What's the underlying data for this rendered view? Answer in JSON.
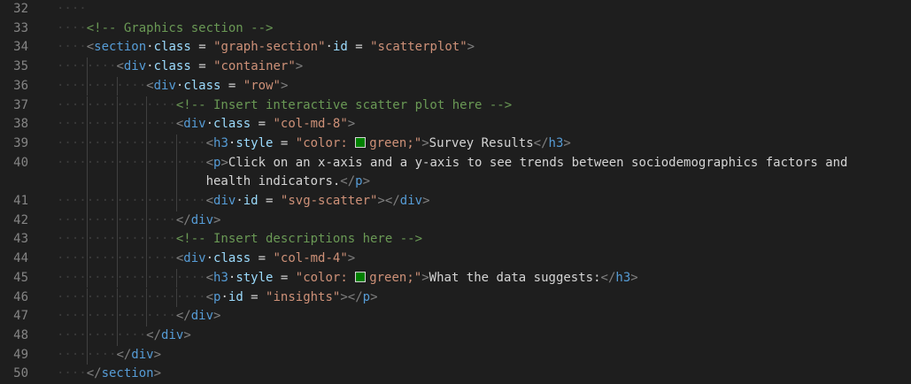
{
  "editor": {
    "swatch_color": "#008000",
    "lines": [
      {
        "number": "32",
        "indent": 4,
        "tokens": []
      },
      {
        "number": "33",
        "indent": 4,
        "tokens": [
          {
            "t": "comment",
            "v": "<!-- Graphics section -->"
          }
        ]
      },
      {
        "number": "34",
        "indent": 4,
        "tokens": [
          {
            "t": "punct",
            "v": "<"
          },
          {
            "t": "tag",
            "v": "section"
          },
          {
            "t": "text",
            "v": " "
          },
          {
            "t": "attr",
            "v": "class"
          },
          {
            "t": "text",
            "v": " = "
          },
          {
            "t": "string",
            "v": "\"graph-section\""
          },
          {
            "t": "text",
            "v": " "
          },
          {
            "t": "attr",
            "v": "id"
          },
          {
            "t": "text",
            "v": " = "
          },
          {
            "t": "string",
            "v": "\"scatterplot\""
          },
          {
            "t": "punct",
            "v": ">"
          }
        ]
      },
      {
        "number": "35",
        "indent": 8,
        "tokens": [
          {
            "t": "punct",
            "v": "<"
          },
          {
            "t": "tag",
            "v": "div"
          },
          {
            "t": "text",
            "v": " "
          },
          {
            "t": "attr",
            "v": "class"
          },
          {
            "t": "text",
            "v": " = "
          },
          {
            "t": "string",
            "v": "\"container\""
          },
          {
            "t": "punct",
            "v": ">"
          }
        ]
      },
      {
        "number": "36",
        "indent": 12,
        "tokens": [
          {
            "t": "punct",
            "v": "<"
          },
          {
            "t": "tag",
            "v": "div"
          },
          {
            "t": "text",
            "v": " "
          },
          {
            "t": "attr",
            "v": "class"
          },
          {
            "t": "text",
            "v": " = "
          },
          {
            "t": "string",
            "v": "\"row\""
          },
          {
            "t": "punct",
            "v": ">"
          }
        ]
      },
      {
        "number": "37",
        "indent": 16,
        "tokens": [
          {
            "t": "comment",
            "v": "<!-- Insert interactive scatter plot here -->"
          }
        ]
      },
      {
        "number": "38",
        "indent": 16,
        "tokens": [
          {
            "t": "punct",
            "v": "<"
          },
          {
            "t": "tag",
            "v": "div"
          },
          {
            "t": "text",
            "v": " "
          },
          {
            "t": "attr",
            "v": "class"
          },
          {
            "t": "text",
            "v": " = "
          },
          {
            "t": "string",
            "v": "\"col-md-8\""
          },
          {
            "t": "punct",
            "v": ">"
          }
        ]
      },
      {
        "number": "39",
        "indent": 20,
        "tokens": [
          {
            "t": "punct",
            "v": "<"
          },
          {
            "t": "tag",
            "v": "h3"
          },
          {
            "t": "text",
            "v": " "
          },
          {
            "t": "attr",
            "v": "style"
          },
          {
            "t": "text",
            "v": " = "
          },
          {
            "t": "string",
            "v": "\"color: "
          },
          {
            "t": "swatch",
            "v": ""
          },
          {
            "t": "string",
            "v": "green;\""
          },
          {
            "t": "punct",
            "v": ">"
          },
          {
            "t": "text",
            "v": "Survey Results"
          },
          {
            "t": "punct",
            "v": "</"
          },
          {
            "t": "tag",
            "v": "h3"
          },
          {
            "t": "punct",
            "v": ">"
          }
        ]
      },
      {
        "number": "40",
        "indent": 20,
        "tokens": [
          {
            "t": "punct",
            "v": "<"
          },
          {
            "t": "tag",
            "v": "p"
          },
          {
            "t": "punct",
            "v": ">"
          },
          {
            "t": "text",
            "v": "Click on an x-axis and a y-axis to see trends between sociodemographics factors and"
          }
        ]
      },
      {
        "number": "",
        "indent": 20,
        "wrap": true,
        "tokens": [
          {
            "t": "text",
            "v": "health indicators."
          },
          {
            "t": "punct",
            "v": "</"
          },
          {
            "t": "tag",
            "v": "p"
          },
          {
            "t": "punct",
            "v": ">"
          }
        ]
      },
      {
        "number": "41",
        "indent": 20,
        "tokens": [
          {
            "t": "punct",
            "v": "<"
          },
          {
            "t": "tag",
            "v": "div"
          },
          {
            "t": "text",
            "v": " "
          },
          {
            "t": "attr",
            "v": "id"
          },
          {
            "t": "text",
            "v": " = "
          },
          {
            "t": "string",
            "v": "\"svg-scatter\""
          },
          {
            "t": "punct",
            "v": "></"
          },
          {
            "t": "tag",
            "v": "div"
          },
          {
            "t": "punct",
            "v": ">"
          }
        ]
      },
      {
        "number": "42",
        "indent": 16,
        "tokens": [
          {
            "t": "punct",
            "v": "</"
          },
          {
            "t": "tag",
            "v": "div"
          },
          {
            "t": "punct",
            "v": ">"
          }
        ]
      },
      {
        "number": "43",
        "indent": 16,
        "tokens": [
          {
            "t": "comment",
            "v": "<!-- Insert descriptions here -->"
          }
        ]
      },
      {
        "number": "44",
        "indent": 16,
        "tokens": [
          {
            "t": "punct",
            "v": "<"
          },
          {
            "t": "tag",
            "v": "div"
          },
          {
            "t": "text",
            "v": " "
          },
          {
            "t": "attr",
            "v": "class"
          },
          {
            "t": "text",
            "v": " = "
          },
          {
            "t": "string",
            "v": "\"col-md-4\""
          },
          {
            "t": "punct",
            "v": ">"
          }
        ]
      },
      {
        "number": "45",
        "indent": 20,
        "tokens": [
          {
            "t": "punct",
            "v": "<"
          },
          {
            "t": "tag",
            "v": "h3"
          },
          {
            "t": "text",
            "v": " "
          },
          {
            "t": "attr",
            "v": "style"
          },
          {
            "t": "text",
            "v": " = "
          },
          {
            "t": "string",
            "v": "\"color: "
          },
          {
            "t": "swatch",
            "v": ""
          },
          {
            "t": "string",
            "v": "green;\""
          },
          {
            "t": "punct",
            "v": ">"
          },
          {
            "t": "text",
            "v": "What the data suggests:"
          },
          {
            "t": "punct",
            "v": "</"
          },
          {
            "t": "tag",
            "v": "h3"
          },
          {
            "t": "punct",
            "v": ">"
          }
        ]
      },
      {
        "number": "46",
        "indent": 20,
        "tokens": [
          {
            "t": "punct",
            "v": "<"
          },
          {
            "t": "tag",
            "v": "p"
          },
          {
            "t": "text",
            "v": " "
          },
          {
            "t": "attr",
            "v": "id"
          },
          {
            "t": "text",
            "v": " = "
          },
          {
            "t": "string",
            "v": "\"insights\""
          },
          {
            "t": "punct",
            "v": "></"
          },
          {
            "t": "tag",
            "v": "p"
          },
          {
            "t": "punct",
            "v": ">"
          }
        ]
      },
      {
        "number": "47",
        "indent": 16,
        "tokens": [
          {
            "t": "punct",
            "v": "</"
          },
          {
            "t": "tag",
            "v": "div"
          },
          {
            "t": "punct",
            "v": ">"
          }
        ]
      },
      {
        "number": "48",
        "indent": 12,
        "tokens": [
          {
            "t": "punct",
            "v": "</"
          },
          {
            "t": "tag",
            "v": "div"
          },
          {
            "t": "punct",
            "v": ">"
          }
        ]
      },
      {
        "number": "49",
        "indent": 8,
        "tokens": [
          {
            "t": "punct",
            "v": "</"
          },
          {
            "t": "tag",
            "v": "div"
          },
          {
            "t": "punct",
            "v": ">"
          }
        ]
      },
      {
        "number": "50",
        "indent": 4,
        "tokens": [
          {
            "t": "punct",
            "v": "</"
          },
          {
            "t": "tag",
            "v": "section"
          },
          {
            "t": "punct",
            "v": ">"
          }
        ]
      }
    ]
  }
}
